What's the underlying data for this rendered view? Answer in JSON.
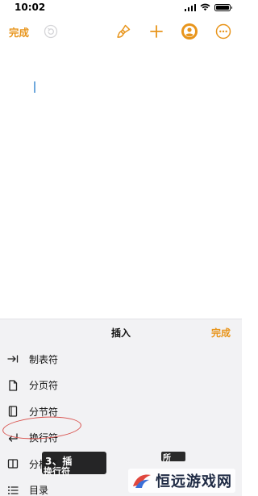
{
  "status_bar": {
    "time": "10:02"
  },
  "toolbar": {
    "done_label": "完成",
    "icons": [
      "undo-icon",
      "paintbrush-icon",
      "plus-icon",
      "collaborate-icon",
      "more-icon"
    ],
    "accent_color": "#e8951c"
  },
  "insert_panel": {
    "title": "插入",
    "done_label": "完成",
    "items": [
      {
        "label": "制表符",
        "icon": "tab-arrow-icon"
      },
      {
        "label": "分页符",
        "icon": "page-icon"
      },
      {
        "label": "分节符",
        "icon": "section-icon"
      },
      {
        "label": "换行符",
        "icon": "line-break-icon"
      },
      {
        "label": "分栏符",
        "icon": "column-icon"
      },
      {
        "label": "目录",
        "icon": "list-icon"
      }
    ]
  },
  "annotation": {
    "caption_line1": "3、插",
    "caption_line2": "换行符",
    "caption_right": "所"
  },
  "watermark": {
    "text": "恒远游戏网"
  }
}
